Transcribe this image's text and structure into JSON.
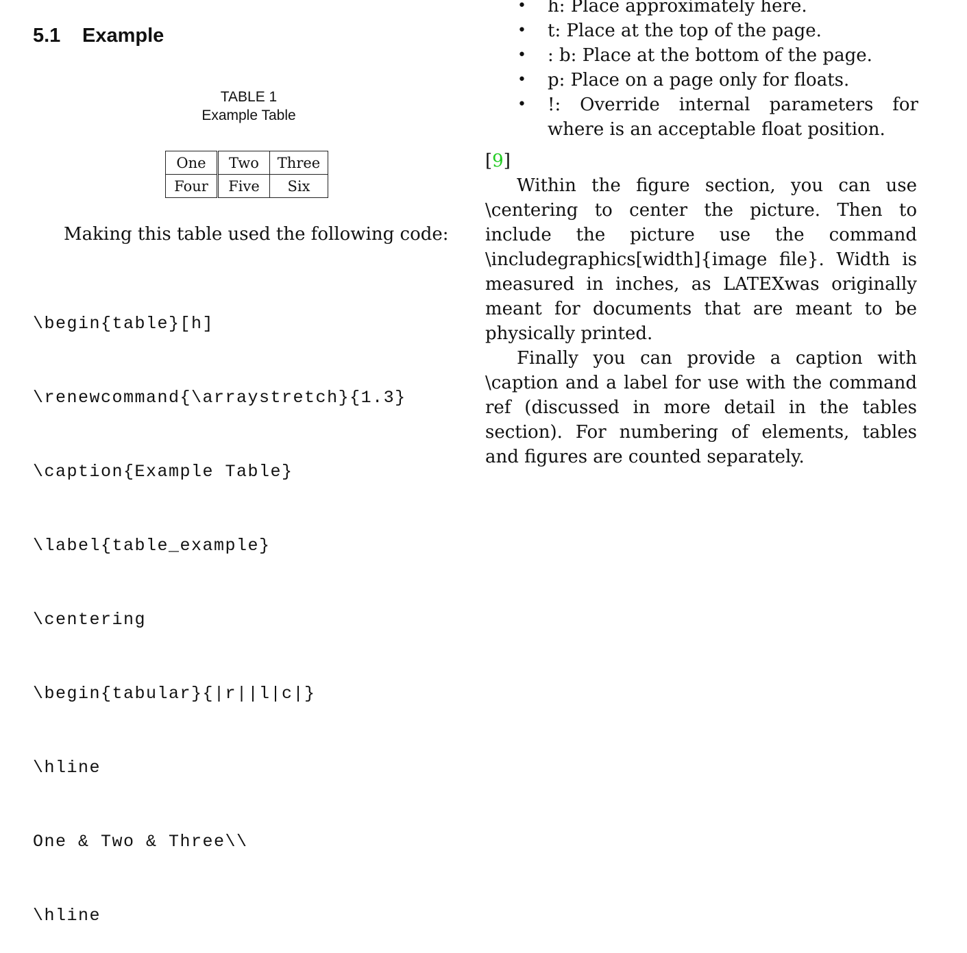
{
  "section": {
    "number": "5.1",
    "title": "Example"
  },
  "table": {
    "label": "TABLE 1",
    "caption": "Example Table",
    "rows": [
      [
        "One",
        "Two",
        "Three"
      ],
      [
        "Four",
        "Five",
        "Six"
      ]
    ]
  },
  "intro": "Making this table used the following code:",
  "code_lines": [
    "\\begin{table}[h]",
    "\\renewcommand{\\arraystretch}{1.3}",
    "\\caption{Example Table}",
    "\\label{table_example}",
    "\\centering",
    "\\begin{tabular}{|r||l|c|}",
    "\\hline",
    "One & Two & Three\\\\",
    "\\hline"
  ],
  "bullets": [
    {
      "marker": "•",
      "text": "h: Place approximately here."
    },
    {
      "marker": "•",
      "text": "t: Place at the top of the page."
    },
    {
      "marker": "•",
      "text": ": b: Place at the bottom of the page."
    },
    {
      "marker": "•",
      "text": "p: Place on a page only for floats."
    },
    {
      "marker": "•",
      "text": "!: Override internal parameters for where is an acceptable float position."
    }
  ],
  "citation": {
    "open": "[",
    "number": "9",
    "close": "]",
    "link_color": "#22cc22"
  },
  "paragraphs": [
    "Within the figure section, you can use \\centering to center the picture. Then to include the picture use the command \\includegraphics[width]{image file}. Width is measured in inches, as LATEXwas originally meant for documents that are meant to be physically printed.",
    "Finally you can provide a caption with \\caption and a label for use with the command ref (discussed in more detail in the tables section). For numbering of elements, tables and figures are counted separately."
  ]
}
